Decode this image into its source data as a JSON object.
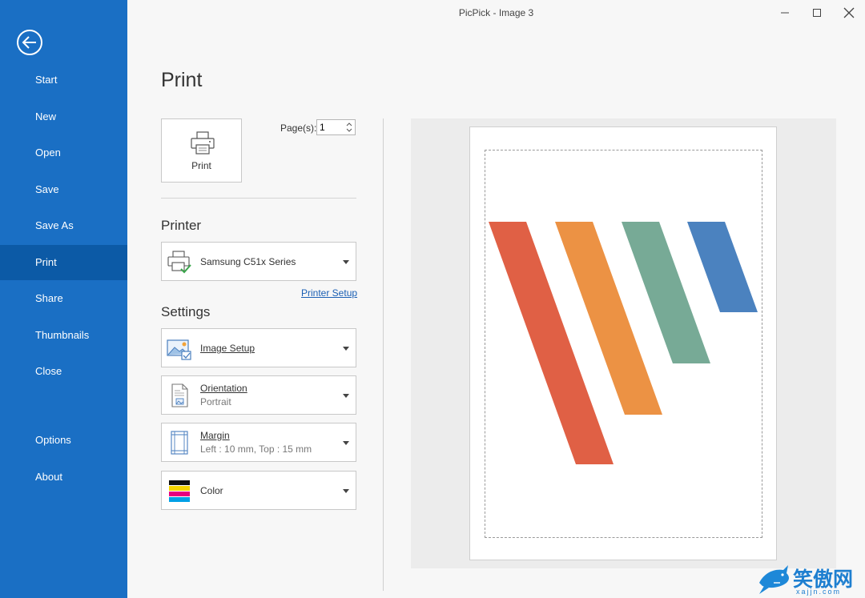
{
  "window": {
    "title": "PicPick - Image 3"
  },
  "sidebar": {
    "items": [
      {
        "label": "Start"
      },
      {
        "label": "New"
      },
      {
        "label": "Open"
      },
      {
        "label": "Save"
      },
      {
        "label": "Save As"
      },
      {
        "label": "Print",
        "active": true
      },
      {
        "label": "Share"
      },
      {
        "label": "Thumbnails"
      },
      {
        "label": "Close"
      },
      {
        "label": "Options"
      },
      {
        "label": "About"
      }
    ]
  },
  "main": {
    "title": "Print",
    "print_button": {
      "label": "Print",
      "icon": "printer-icon"
    },
    "pages": {
      "label": "Page(s):",
      "value": "1"
    },
    "printer": {
      "heading": "Printer",
      "selected": "Samsung C51x Series",
      "setup_link": "Printer Setup"
    },
    "settings": {
      "heading": "Settings",
      "image_setup": {
        "label": "Image Setup"
      },
      "orientation": {
        "label": "Orientation",
        "value": "Portrait"
      },
      "margin": {
        "label": "Margin",
        "value": "Left : 10 mm, Top : 15 mm"
      },
      "color": {
        "label": "Color"
      }
    }
  },
  "preview": {
    "stripe_colors": [
      "#e06045",
      "#ec9244",
      "#77aa96",
      "#4b82bf"
    ]
  },
  "watermark": {
    "text": "笑傲网",
    "sub": "xajjn.com"
  },
  "colors": {
    "sidebar_bg": "#1a6fc4",
    "sidebar_active": "#0c5aa6",
    "link": "#1a5fb4"
  }
}
